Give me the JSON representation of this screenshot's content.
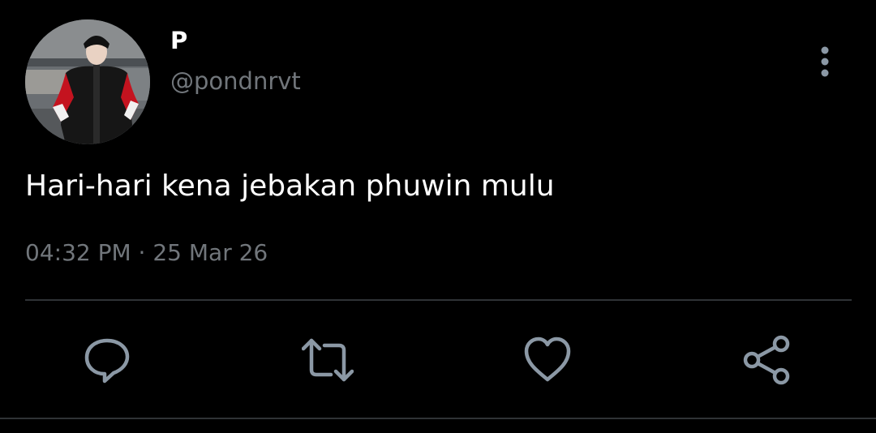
{
  "tweet": {
    "author": {
      "display_name": "P",
      "handle": "@pondnrvt"
    },
    "text": "Hari-hari kena jebakan phuwin mulu",
    "time": "04:32 PM",
    "separator": "·",
    "date": "25 Mar 26"
  },
  "actions": [
    {
      "name": "reply",
      "icon": "reply-icon"
    },
    {
      "name": "retweet",
      "icon": "retweet-icon"
    },
    {
      "name": "like",
      "icon": "heart-icon"
    },
    {
      "name": "share",
      "icon": "share-icon"
    }
  ],
  "colors": {
    "background": "#000000",
    "primary_text": "#ffffff",
    "secondary_text": "#71767b",
    "divider": "#2f3336"
  }
}
